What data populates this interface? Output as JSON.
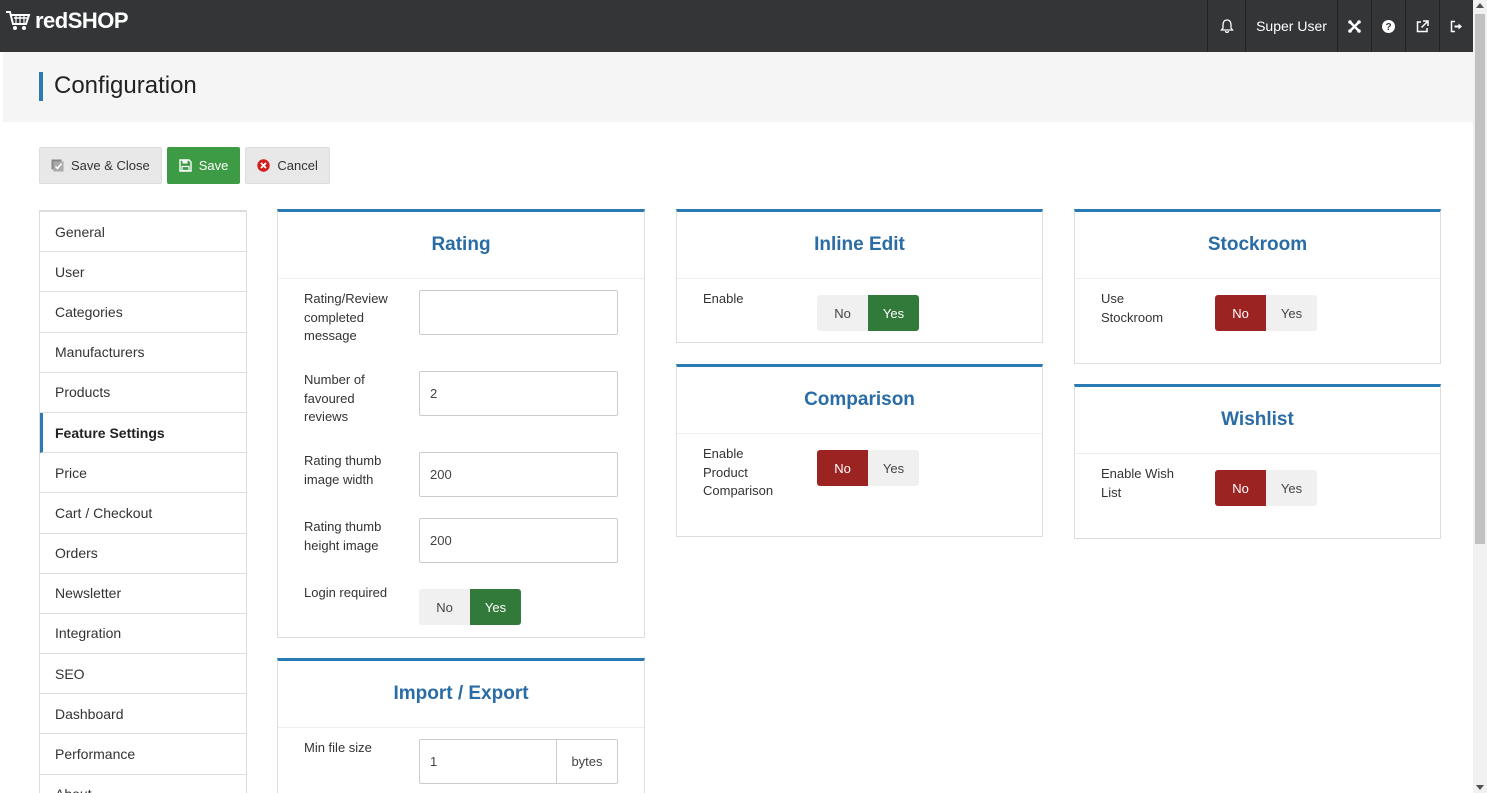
{
  "app": {
    "logo_text": "redSHOP"
  },
  "topbar": {
    "user_name": "Super User"
  },
  "page": {
    "title": "Configuration"
  },
  "toolbar": {
    "save_close_label": "Save & Close",
    "save_label": "Save",
    "cancel_label": "Cancel"
  },
  "colors": {
    "accent": "#2a7ab4",
    "success": "#3e9b45",
    "toggle_yes": "#327a3a",
    "toggle_no": "#9b2322"
  },
  "sidebar": {
    "items": [
      {
        "label": "General"
      },
      {
        "label": "User"
      },
      {
        "label": "Categories"
      },
      {
        "label": "Manufacturers"
      },
      {
        "label": "Products"
      },
      {
        "label": "Feature Settings",
        "active": true
      },
      {
        "label": "Price"
      },
      {
        "label": "Cart / Checkout"
      },
      {
        "label": "Orders"
      },
      {
        "label": "Newsletter"
      },
      {
        "label": "Integration"
      },
      {
        "label": "SEO"
      },
      {
        "label": "Dashboard"
      },
      {
        "label": "Performance"
      },
      {
        "label": "About"
      }
    ]
  },
  "rating": {
    "title": "Rating",
    "completed_message_label": "Rating/Review completed message",
    "completed_message_value": "",
    "favoured_reviews_label": "Number of favoured reviews",
    "favoured_reviews_value": "2",
    "thumb_width_label": "Rating thumb image width",
    "thumb_width_value": "200",
    "thumb_height_label": "Rating thumb height image",
    "thumb_height_value": "200",
    "login_required_label": "Login required",
    "login_required_value": "Yes"
  },
  "import_export": {
    "title": "Import / Export",
    "min_file_size_label": "Min file size",
    "min_file_size_value": "1",
    "min_file_size_unit": "bytes"
  },
  "inline_edit": {
    "title": "Inline Edit",
    "enable_label": "Enable",
    "enable_value": "Yes"
  },
  "comparison": {
    "title": "Comparison",
    "enable_label": "Enable Product Comparison",
    "enable_value": "No"
  },
  "stockroom": {
    "title": "Stockroom",
    "use_label": "Use Stockroom",
    "use_value": "No"
  },
  "wishlist": {
    "title": "Wishlist",
    "enable_label": "Enable Wish List",
    "enable_value": "No"
  },
  "toggle_labels": {
    "no": "No",
    "yes": "Yes"
  }
}
